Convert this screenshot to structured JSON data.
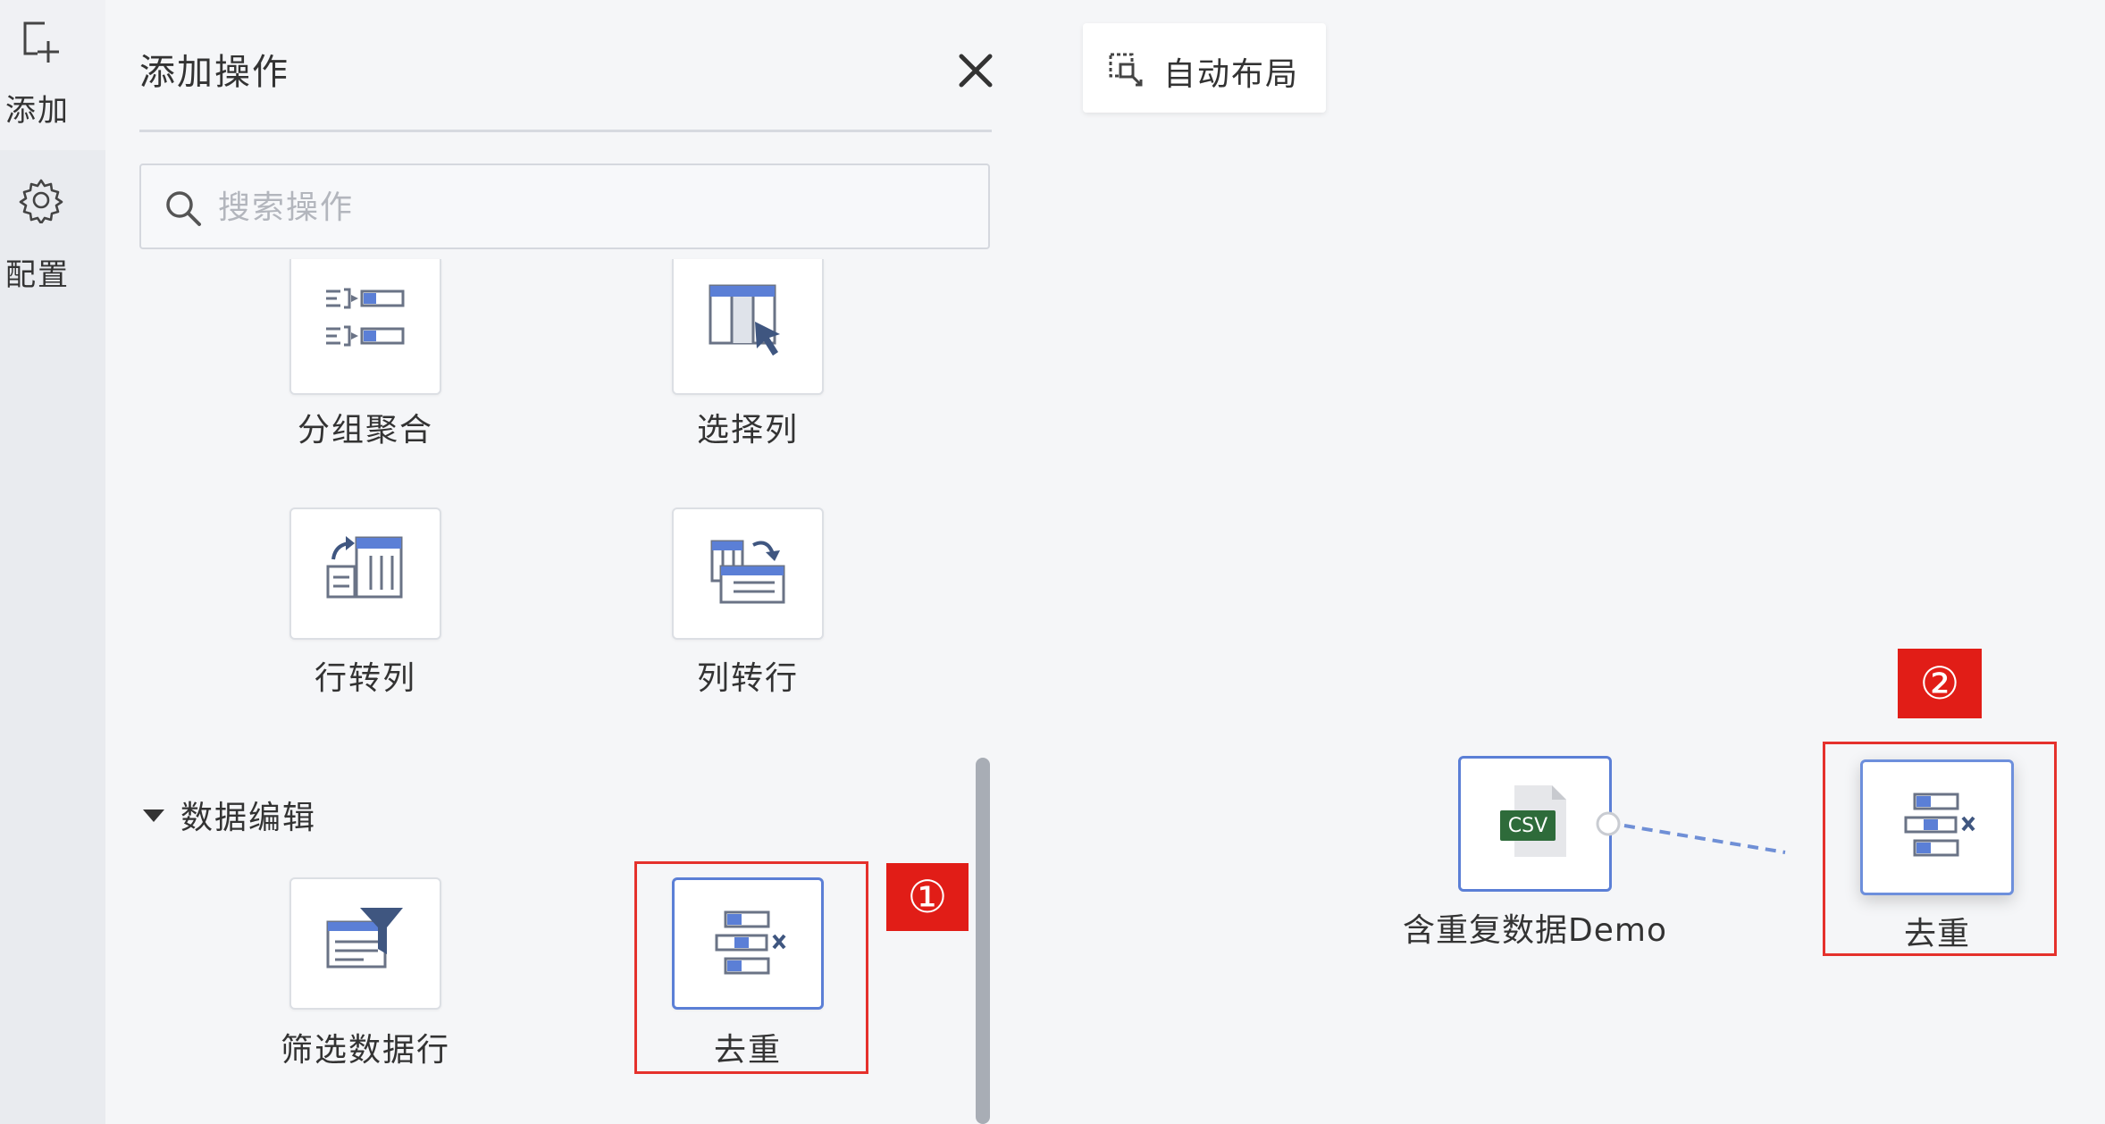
{
  "rail": {
    "add_label": "添加",
    "config_label": "配置"
  },
  "panel": {
    "title": "添加操作",
    "search_placeholder": "搜索操作",
    "tiles": [
      {
        "label": "分组聚合",
        "icon": "group-aggregate-icon"
      },
      {
        "label": "选择列",
        "icon": "select-column-icon"
      },
      {
        "label": "行转列",
        "icon": "row-to-column-icon"
      },
      {
        "label": "列转行",
        "icon": "column-to-row-icon"
      }
    ],
    "section": {
      "title": "数据编辑",
      "tiles": [
        {
          "label": "筛选数据行",
          "icon": "filter-rows-icon"
        },
        {
          "label": "去重",
          "icon": "dedupe-icon",
          "selected": true
        }
      ]
    },
    "badge1": "①"
  },
  "canvas": {
    "auto_layout_label": "自动布局",
    "source_node": {
      "label": "含重复数据Demo",
      "badge": "CSV"
    },
    "dedupe_node": {
      "label": "去重"
    },
    "badge2": "②"
  },
  "colors": {
    "accent": "#5b7fd6",
    "annotation_red": "#e11d17",
    "csv_green": "#2e6b3a"
  }
}
